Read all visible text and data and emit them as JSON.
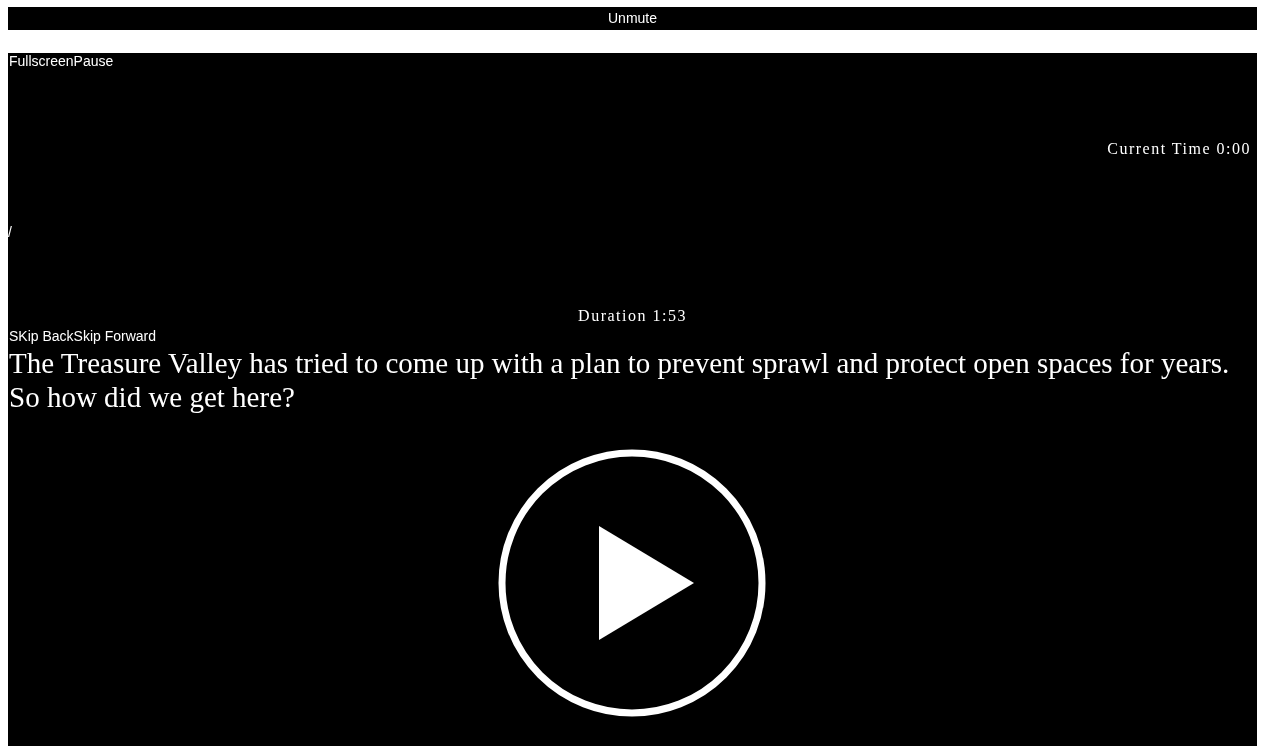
{
  "mute_button": {
    "label": "Unmute"
  },
  "top_controls": [
    {
      "label": "Fullscreen"
    },
    {
      "label": "Pause"
    }
  ],
  "current_time": "Current Time 0:00",
  "time_separator": "/",
  "duration": "Duration 1:53",
  "skip_controls": [
    {
      "label": "SKip Back"
    },
    {
      "label": "Skip Forward"
    }
  ],
  "caption": "The Treasure Valley has tried to come up with a plan to prevent sprawl and protect open spaces for years. So how did we get here?"
}
